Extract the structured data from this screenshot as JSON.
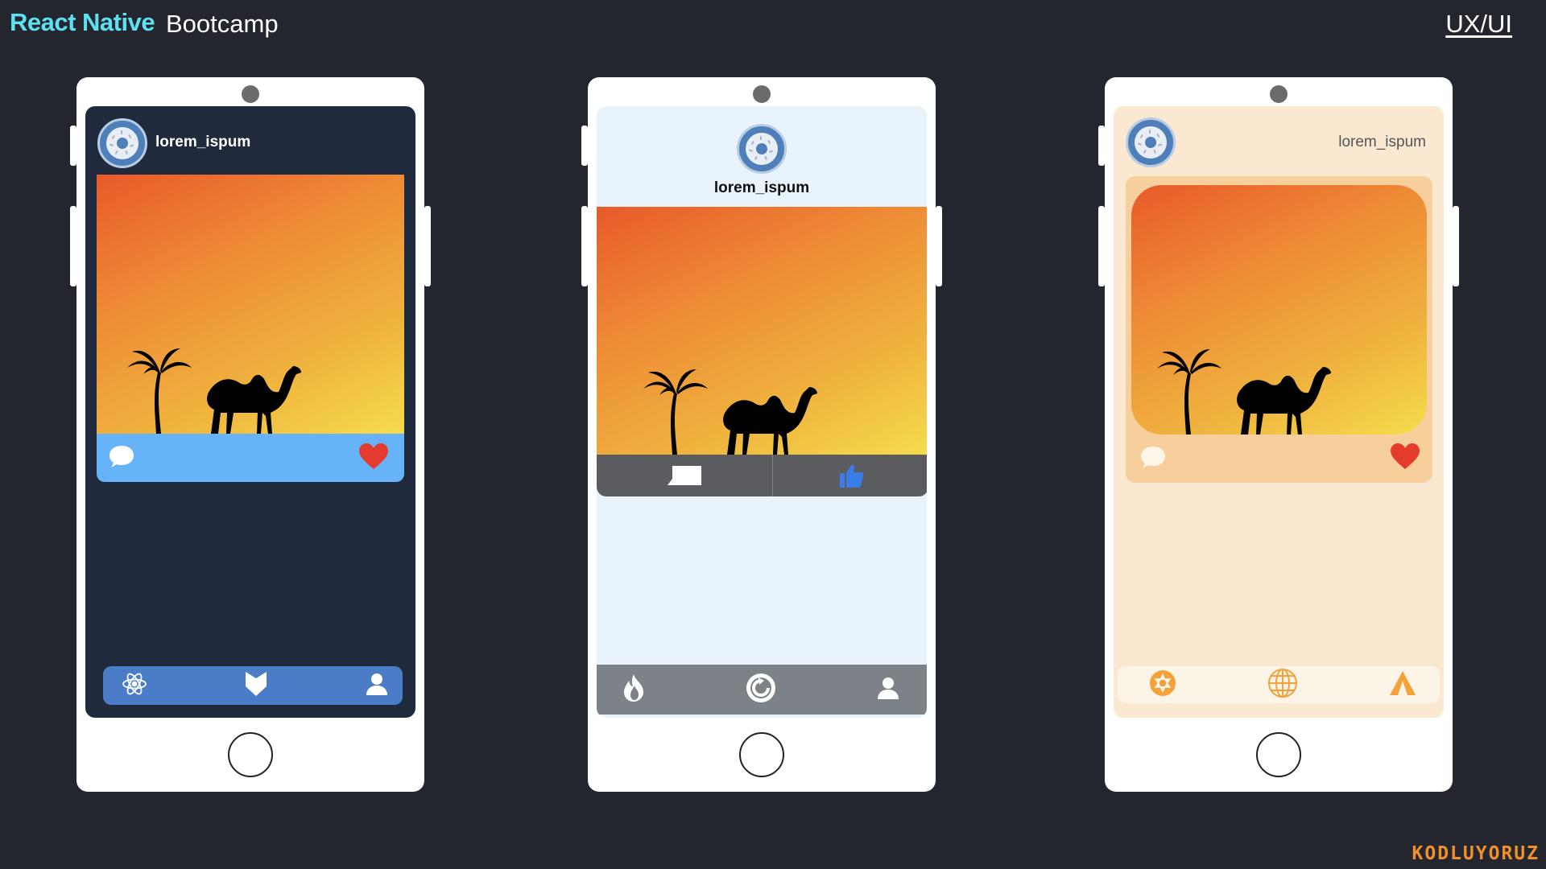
{
  "header": {
    "brand": "React Native",
    "subtitle": "Bootcamp",
    "link": "UX/UI"
  },
  "footer": {
    "logo": "KODLUYORUZ"
  },
  "colors": {
    "brand": "#5ee0f0",
    "background": "#23262e",
    "screen1_bg": "#1f2a3d",
    "screen1_action": "#66b4f7",
    "screen1_tab": "#4a7cc7",
    "screen2_bg": "#e8f3fc",
    "screen2_action": "#5a5c5f",
    "screen2_tab": "#7d8288",
    "screen3_bg": "#fbe8d0",
    "screen3_card": "#f7cf9d",
    "screen3_accent": "#f3a23a",
    "heart": "#e53b2c",
    "like": "#3a7de8"
  },
  "phones": [
    {
      "username": "lorem_ispum",
      "actions": [
        "comment-icon",
        "heart-icon"
      ],
      "tabs": [
        "atom-icon",
        "download-arrow-icon",
        "user-icon"
      ]
    },
    {
      "username": "lorem_ispum",
      "actions": [
        "comment-icon",
        "thumbs-up-icon"
      ],
      "tabs": [
        "flame-icon",
        "refresh-icon",
        "user-icon"
      ]
    },
    {
      "username": "lorem_ispum",
      "actions": [
        "comment-icon",
        "heart-icon"
      ],
      "tabs": [
        "aperture-icon",
        "globe-icon",
        "tent-icon"
      ]
    }
  ]
}
